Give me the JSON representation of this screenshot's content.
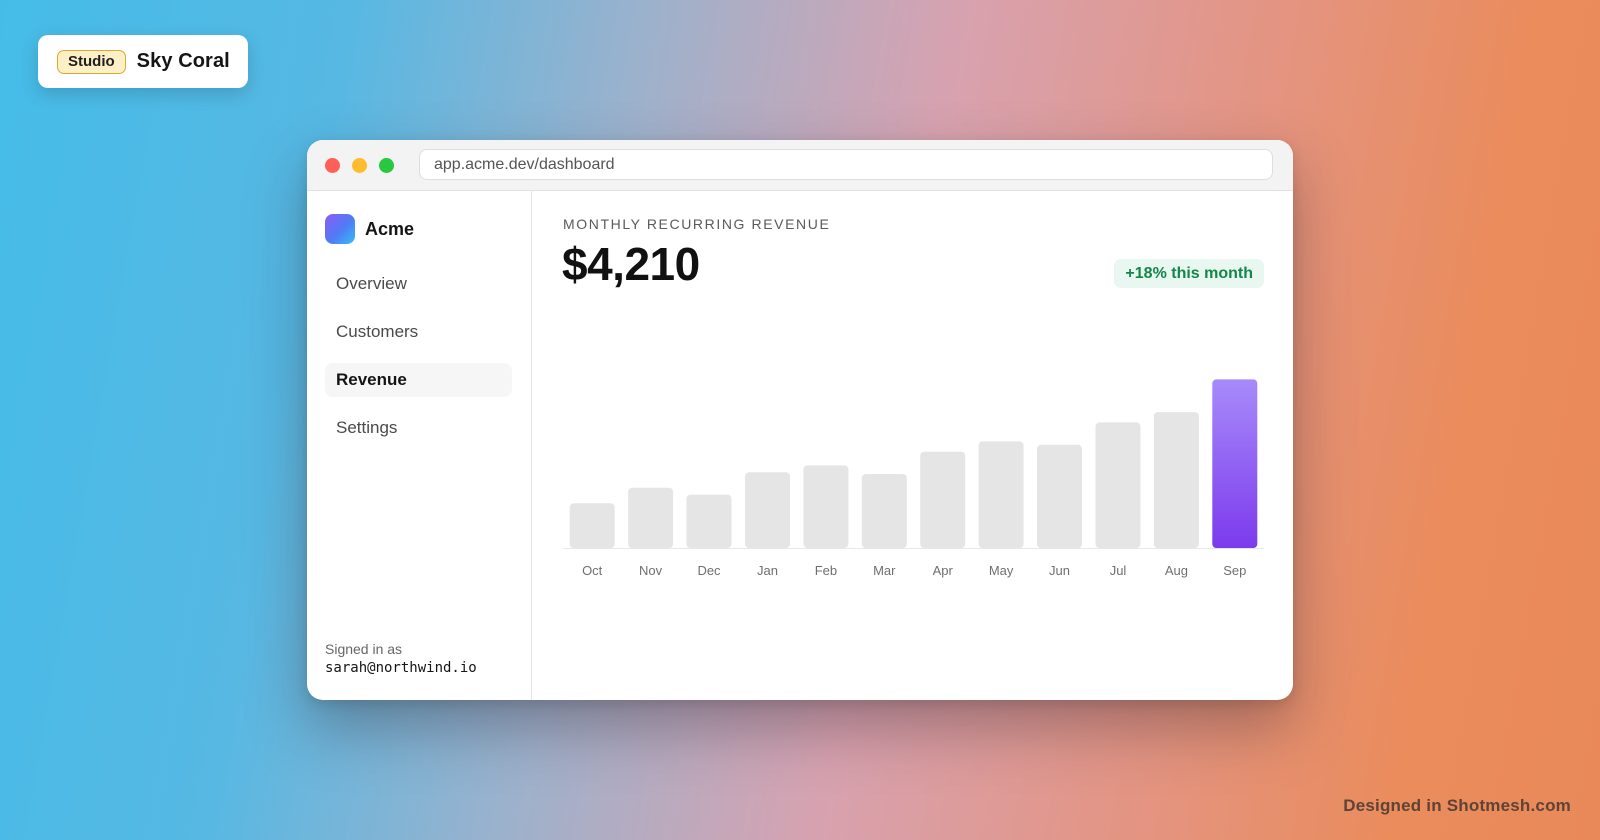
{
  "badge": {
    "tag": "Studio",
    "name": "Sky Coral"
  },
  "window": {
    "url": "app.acme.dev/dashboard"
  },
  "sidebar": {
    "brand": "Acme",
    "items": [
      {
        "label": "Overview",
        "active": false
      },
      {
        "label": "Customers",
        "active": false
      },
      {
        "label": "Revenue",
        "active": true
      },
      {
        "label": "Settings",
        "active": false
      }
    ],
    "signed_in_label": "Signed in as",
    "signed_in_email": "sarah@northwind.io"
  },
  "main": {
    "metric_label": "MONTHLY RECURRING REVENUE",
    "metric_value": "$4,210",
    "growth_badge": "+18% this month"
  },
  "colors": {
    "bar_default": "#e5e5e5",
    "bar_highlight_top": "#a78bfa",
    "bar_highlight_bottom": "#7c3aed",
    "growth_text": "#14864b",
    "growth_bg": "#e8f7ef"
  },
  "credit": "Designed in Shotmesh.com",
  "chart_data": {
    "type": "bar",
    "categories": [
      "Oct",
      "Nov",
      "Dec",
      "Jan",
      "Feb",
      "Mar",
      "Apr",
      "May",
      "Jun",
      "Jul",
      "Aug",
      "Sep"
    ],
    "values": [
      26,
      35,
      31,
      44,
      48,
      43,
      56,
      62,
      60,
      73,
      79,
      98
    ],
    "highlight_index": 11,
    "ylim": [
      0,
      100
    ],
    "grid": false,
    "legend": "none"
  }
}
